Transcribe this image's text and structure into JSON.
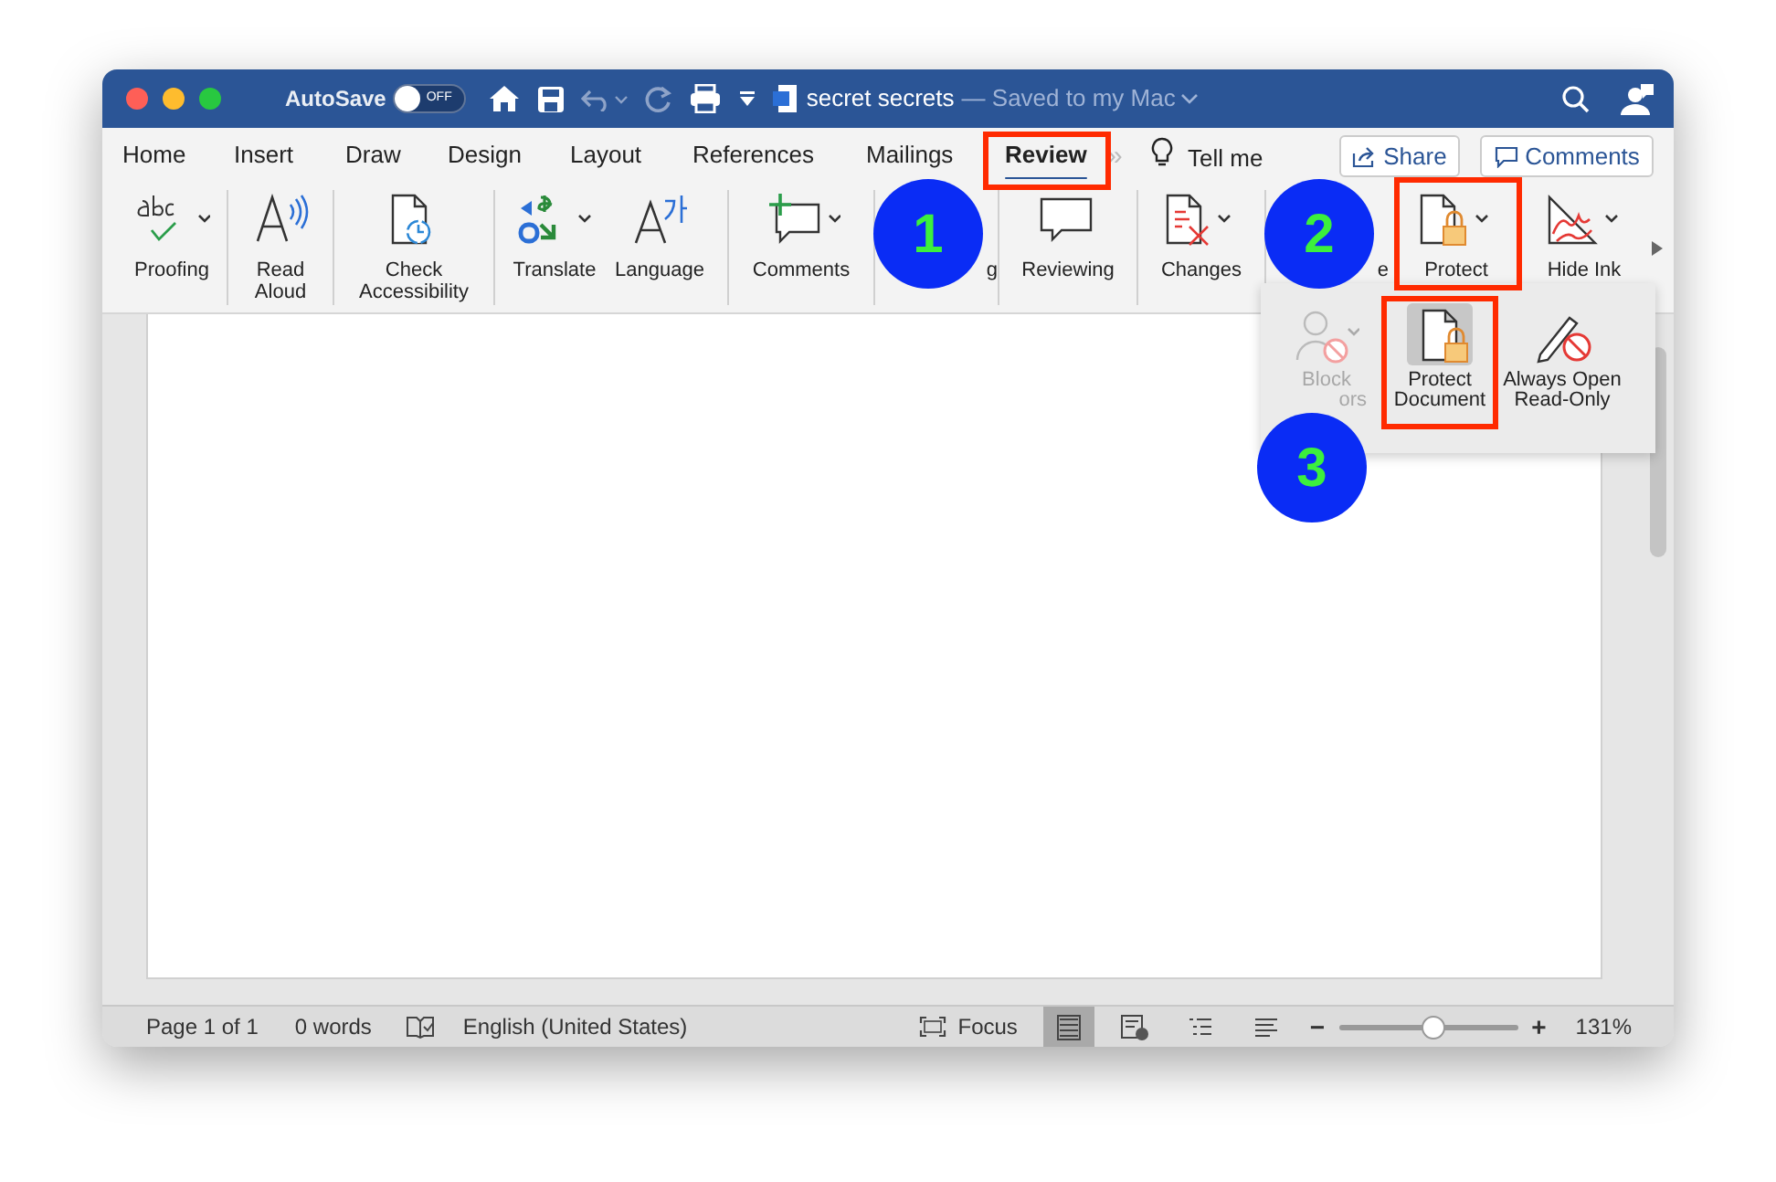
{
  "title_bar": {
    "autosave_label": "AutoSave",
    "autosave_toggle": {
      "text": "OFF",
      "on": false
    },
    "document_title": "secret secrets",
    "save_status": "— Saved to my Mac"
  },
  "tabs": [
    {
      "label": "Home",
      "selected": false
    },
    {
      "label": "Insert",
      "selected": false
    },
    {
      "label": "Draw",
      "selected": false
    },
    {
      "label": "Design",
      "selected": false
    },
    {
      "label": "Layout",
      "selected": false
    },
    {
      "label": "References",
      "selected": false
    },
    {
      "label": "Mailings",
      "selected": false
    },
    {
      "label": "Review",
      "selected": true
    }
  ],
  "overflow_chevron": "»",
  "tell_me": "Tell me",
  "share_button": "Share",
  "comments_button": "Comments",
  "ribbon": [
    {
      "kind": "button",
      "label_lines": [
        "Proofing"
      ]
    },
    {
      "kind": "button",
      "label_lines": [
        "Read",
        "Aloud"
      ]
    },
    {
      "kind": "button",
      "label_lines": [
        "Check",
        "Accessibility"
      ]
    },
    {
      "kind": "button",
      "label_lines": [
        "Translate"
      ]
    },
    {
      "kind": "button",
      "label_lines": [
        "Language"
      ]
    },
    {
      "kind": "button",
      "label_lines": [
        "Comments"
      ]
    },
    {
      "kind": "fragment",
      "label_lines": [
        "g"
      ]
    },
    {
      "kind": "button",
      "label_lines": [
        "Reviewing"
      ]
    },
    {
      "kind": "button",
      "label_lines": [
        "Changes"
      ]
    },
    {
      "kind": "fragment",
      "label_lines": [
        "e"
      ]
    },
    {
      "kind": "button",
      "label_lines": [
        "Protect"
      ]
    },
    {
      "kind": "button",
      "label_lines": [
        "Hide Ink"
      ]
    }
  ],
  "protect_menu": [
    {
      "label_lines": [
        "Block",
        "ors"
      ],
      "disabled": true,
      "selected": false
    },
    {
      "label_lines": [
        "Protect",
        "Document"
      ],
      "disabled": false,
      "selected": true
    },
    {
      "label_lines": [
        "Always Open",
        "Read-Only"
      ],
      "disabled": false,
      "selected": false
    }
  ],
  "annotations": [
    {
      "kind": "box"
    },
    {
      "kind": "box"
    },
    {
      "kind": "box"
    },
    {
      "kind": "badge",
      "label": "1"
    },
    {
      "kind": "badge",
      "label": "2"
    },
    {
      "kind": "badge",
      "label": "3"
    }
  ],
  "status_bar": {
    "page": "Page 1 of 1",
    "words": "0 words",
    "language": "English (United States)",
    "focus": "Focus",
    "views": [
      {
        "selected": true
      },
      {
        "selected": false
      },
      {
        "selected": false
      },
      {
        "selected": false
      }
    ],
    "zoom_minus": "−",
    "zoom": {
      "level": 0.53
    },
    "zoom_plus": "+",
    "zoom_percent": "131%"
  }
}
